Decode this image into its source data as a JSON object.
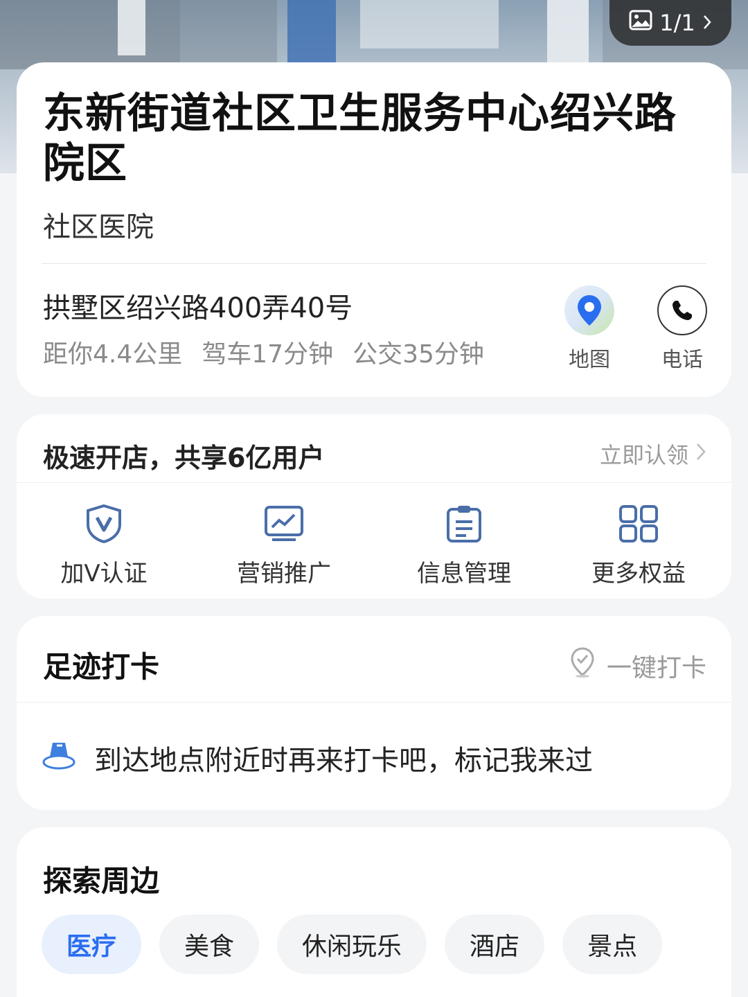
{
  "photo": {
    "counter": "1/1"
  },
  "poi": {
    "name": "东新街道社区卫生服务中心绍兴路院区",
    "category": "社区医院",
    "address": "拱墅区绍兴路400弄40号",
    "distance": "距你4.4公里",
    "drive": "驾车17分钟",
    "bus": "公交35分钟",
    "actions": {
      "map": "地图",
      "phone": "电话"
    }
  },
  "store": {
    "headline": "极速开店，共享6亿用户",
    "claim": "立即认领",
    "features": [
      {
        "label": "加V认证",
        "icon": "verified-shield-icon"
      },
      {
        "label": "营销推广",
        "icon": "chart-monitor-icon"
      },
      {
        "label": "信息管理",
        "icon": "clipboard-icon"
      },
      {
        "label": "更多权益",
        "icon": "grid-icon"
      }
    ]
  },
  "checkin": {
    "title": "足迹打卡",
    "button": "一键打卡",
    "tip": "到达地点附近时再来打卡吧，标记我来过"
  },
  "explore": {
    "title": "探索周边",
    "chips": [
      "医疗",
      "美食",
      "休闲玩乐",
      "酒店",
      "景点"
    ],
    "active": "医疗"
  },
  "colors": {
    "accent": "#2a6ef0",
    "text_muted": "#9a9a9a",
    "background": "#f4f5f7"
  }
}
